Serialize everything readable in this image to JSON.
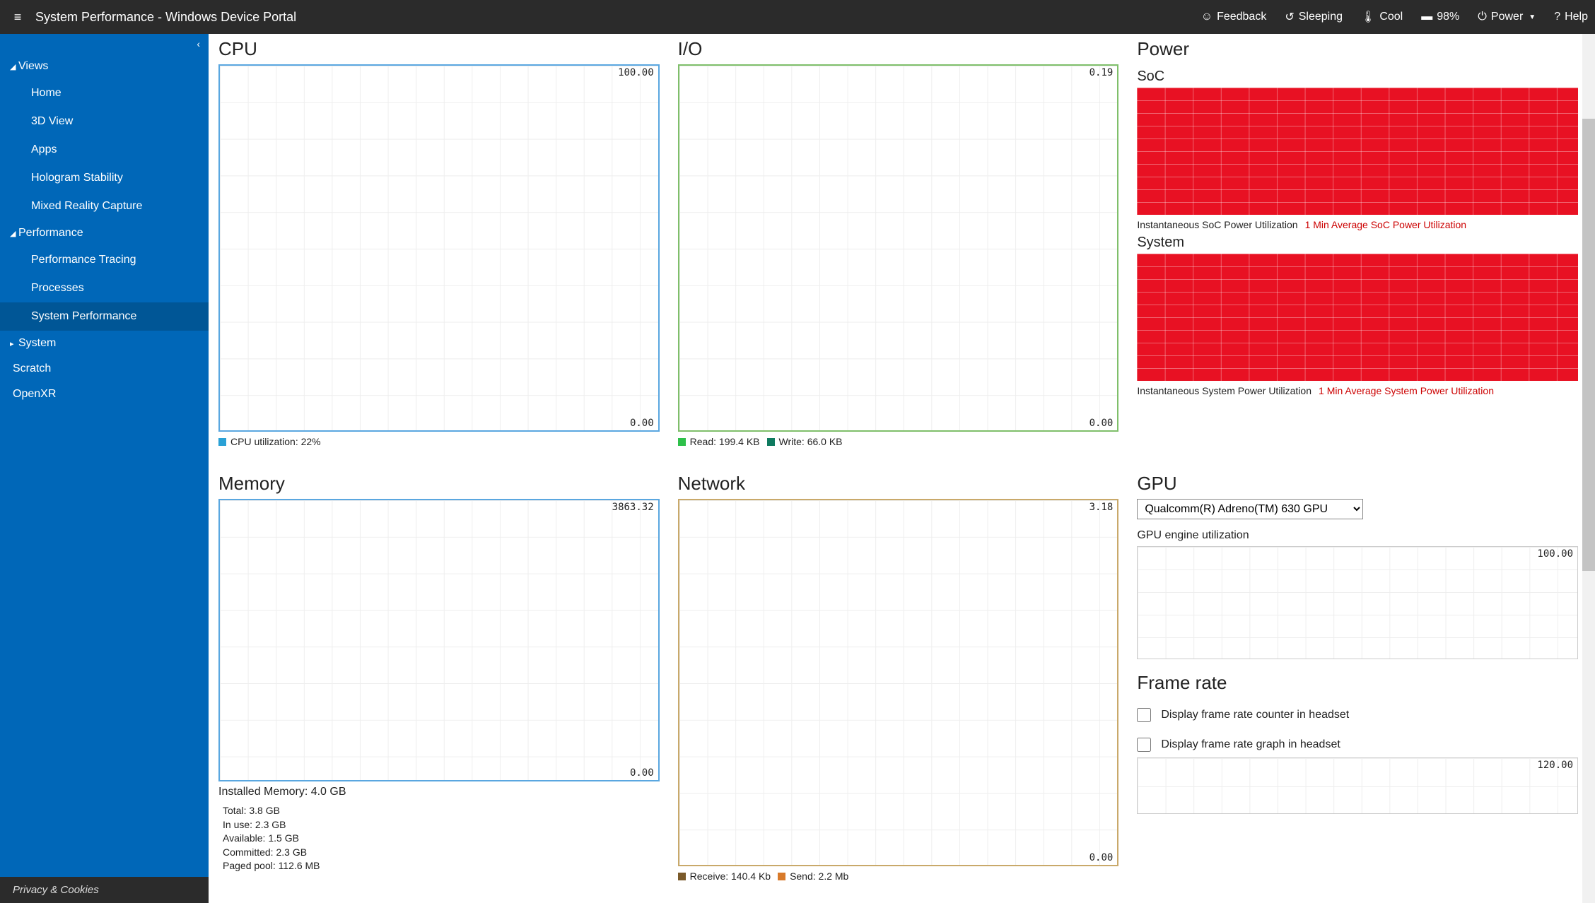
{
  "title": "System Performance - Windows Device Portal",
  "topbar": {
    "feedback": "Feedback",
    "sleeping": "Sleeping",
    "cool": "Cool",
    "battery": "98%",
    "power": "Power",
    "help": "Help"
  },
  "sidebar": {
    "views_label": "Views",
    "views": [
      "Home",
      "3D View",
      "Apps",
      "Hologram Stability",
      "Mixed Reality Capture"
    ],
    "performance_label": "Performance",
    "performance": [
      "Performance Tracing",
      "Processes",
      "System Performance"
    ],
    "active": "System Performance",
    "system_label": "System",
    "scratch": "Scratch",
    "openxr": "OpenXR",
    "privacy": "Privacy & Cookies"
  },
  "cpu": {
    "title": "CPU",
    "max": "100.00",
    "min": "0.00",
    "legend": "CPU utilization: 22%"
  },
  "io": {
    "title": "I/O",
    "max": "0.19",
    "min": "0.00",
    "read": "Read: 199.4 KB",
    "write": "Write: 66.0 KB"
  },
  "power": {
    "title": "Power",
    "soc_label": "SoC",
    "soc_inst": "Instantaneous SoC Power Utilization",
    "soc_avg": "1 Min Average SoC Power Utilization",
    "sys_label": "System",
    "sys_inst": "Instantaneous System Power Utilization",
    "sys_avg": "1 Min Average System Power Utilization"
  },
  "memory": {
    "title": "Memory",
    "max": "3863.32",
    "min": "0.00",
    "installed": "Installed Memory: 4.0 GB",
    "stats": [
      {
        "c": "#e81123",
        "t": "Total: 3.8 GB"
      },
      {
        "c": "#2aa1d6",
        "t": "In use: 2.3 GB"
      },
      {
        "c": "#2ec04a",
        "t": "Available: 1.5 GB"
      },
      {
        "c": "#7b3fbf",
        "t": "Committed: 2.3 GB"
      },
      {
        "c": "#e040a0",
        "t": "Paged pool: 112.6 MB"
      }
    ]
  },
  "network": {
    "title": "Network",
    "max": "3.18",
    "min": "0.00",
    "recv": "Receive: 140.4 Kb",
    "send": "Send: 2.2 Mb"
  },
  "gpu": {
    "title": "GPU",
    "select": "Qualcomm(R) Adreno(TM) 630 GPU",
    "engine_label": "GPU engine utilization",
    "max": "100.00"
  },
  "framerate": {
    "title": "Frame rate",
    "counter": "Display frame rate counter in headset",
    "graph": "Display frame rate graph in headset",
    "max": "120.00"
  },
  "chart_data": [
    {
      "type": "line",
      "title": "CPU utilization",
      "ylim": [
        0,
        100
      ],
      "series": [
        {
          "name": "CPU utilization",
          "latest": 22
        }
      ]
    },
    {
      "type": "line",
      "title": "I/O",
      "ylim": [
        0,
        0.19
      ],
      "series": [
        {
          "name": "Read",
          "latest_kb": 199.4
        },
        {
          "name": "Write",
          "latest_kb": 66.0
        }
      ]
    },
    {
      "type": "line",
      "title": "Memory",
      "ylim": [
        0,
        3863.32
      ],
      "series": [
        {
          "name": "Total",
          "value_gb": 3.8
        },
        {
          "name": "In use",
          "value_gb": 2.3
        },
        {
          "name": "Available",
          "value_gb": 1.5
        },
        {
          "name": "Committed",
          "value_gb": 2.3
        },
        {
          "name": "Paged pool",
          "value_mb": 112.6
        }
      ],
      "installed_gb": 4.0
    },
    {
      "type": "line",
      "title": "Network",
      "ylim": [
        0,
        3.18
      ],
      "series": [
        {
          "name": "Receive",
          "latest_kb": 140.4
        },
        {
          "name": "Send",
          "latest_mb": 2.2
        }
      ]
    },
    {
      "type": "area",
      "title": "SoC Power",
      "ylim": [
        0,
        1
      ],
      "series": [
        {
          "name": "Instantaneous",
          "fill": 1.0
        },
        {
          "name": "1 Min Average",
          "fill": 1.0
        }
      ]
    },
    {
      "type": "area",
      "title": "System Power",
      "ylim": [
        0,
        1
      ],
      "series": [
        {
          "name": "Instantaneous",
          "fill": 1.0
        },
        {
          "name": "1 Min Average",
          "fill": 1.0
        }
      ]
    },
    {
      "type": "line",
      "title": "GPU engine utilization",
      "ylim": [
        0,
        100
      ]
    },
    {
      "type": "line",
      "title": "Frame rate",
      "ylim": [
        0,
        120
      ]
    }
  ]
}
